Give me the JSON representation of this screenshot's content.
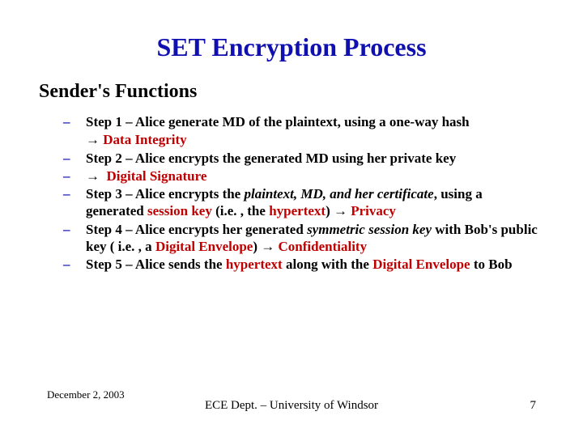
{
  "title": "SET Encryption Process",
  "subtitle": "Sender's Functions",
  "arrow": "→",
  "steps": {
    "s1a": "Step 1 – Alice generate MD of the plaintext, using a one-way hash",
    "s1b_arrow": "→",
    "s1b_red": "Data Integrity",
    "s2": "Step 2 – Alice encrypts the generated MD using her private key",
    "s2b_arrow": "→",
    "s2b_red": "Digital Signature",
    "s3a": "Step 3 – Alice encrypts the ",
    "s3a_it": "plaintext, MD, and her certificate",
    "s3a_end": ", using a generated ",
    "s3a_red1": "session key",
    "s3a_mid": " (i.e. , the ",
    "s3a_red2": "hypertext",
    "s3a_close": ") ",
    "s3a_arrow": "→",
    "s3a_red3": "Privacy",
    "s4a": "Step 4 – Alice encrypts her generated ",
    "s4a_it": "symmetric session key",
    "s4a_mid": " with Bob's public key ( i.e. , a ",
    "s4a_red1": "Digital Envelope",
    "s4a_close": ") ",
    "s4a_arrow": "→",
    "s4a_red2": "Confidentiality",
    "s5a": " Step 5 – Alice sends the ",
    "s5a_red1": "hypertext",
    "s5a_mid": " along with the ",
    "s5a_red2": "Digital Envelope",
    "s5a_end": " to Bob"
  },
  "footer": {
    "date": "December 2, 2003",
    "center": "ECE Dept. – University of Windsor",
    "page": "7"
  }
}
